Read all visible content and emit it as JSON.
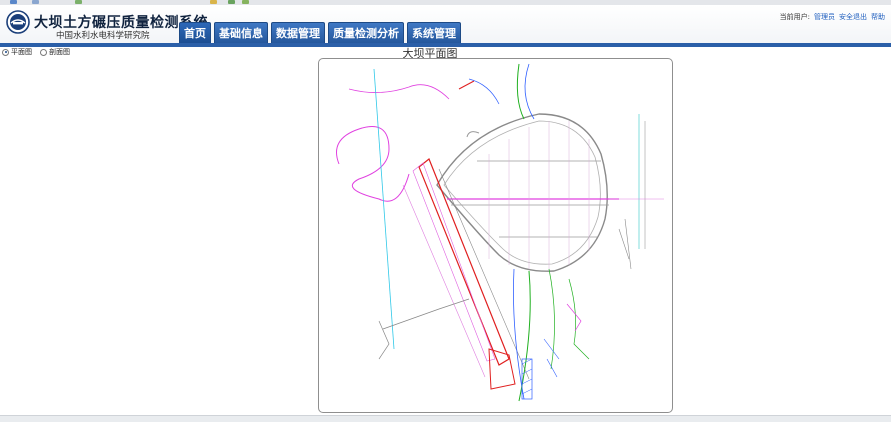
{
  "app": {
    "title": "大坝土方碾压质量检测系统",
    "subtitle": "中国水利水电科学研究院",
    "logo_icon": "institute-logo-icon"
  },
  "nav": {
    "tabs": [
      {
        "label": "首页",
        "active": true
      },
      {
        "label": "基础信息",
        "active": false
      },
      {
        "label": "数据管理",
        "active": false
      },
      {
        "label": "质量检测分析",
        "active": false
      },
      {
        "label": "系统管理",
        "active": false
      }
    ]
  },
  "user": {
    "prefix": "当前用户:",
    "name": "管理员",
    "logout": "安全退出",
    "help": "帮助"
  },
  "view_toggle": {
    "options": [
      "平面图",
      "剖面图"
    ],
    "selected": "平面图"
  },
  "map": {
    "title": "大坝平面图"
  },
  "colors": {
    "nav_blue": "#2b5fa8",
    "link": "#1f5fbf",
    "cad_magenta": "#e040e0",
    "cad_red": "#e02020",
    "cad_green": "#20b020",
    "cad_blue": "#3060ff",
    "cad_cyan": "#30c8e8"
  }
}
